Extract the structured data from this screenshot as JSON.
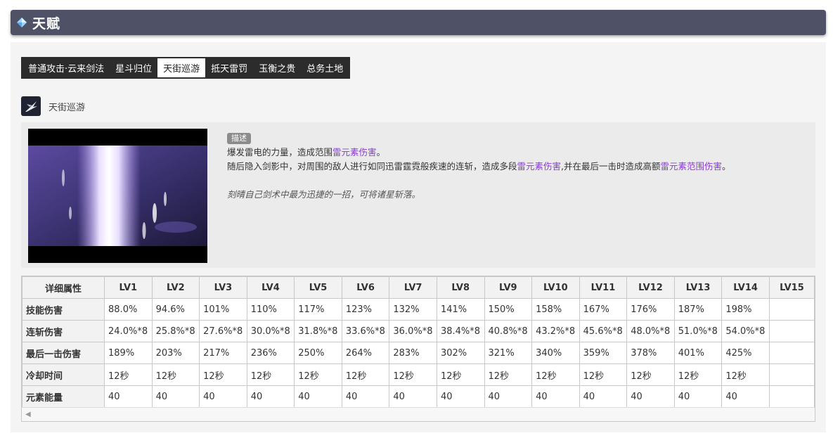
{
  "header": {
    "title": "天赋",
    "icon": "gem-icon",
    "bg_color": "#4f5266"
  },
  "tabs": [
    {
      "label": "普通攻击·云来剑法",
      "active": false
    },
    {
      "label": "星斗归位",
      "active": false
    },
    {
      "label": "天街巡游",
      "active": true
    },
    {
      "label": "抵天雷罚",
      "active": false
    },
    {
      "label": "玉衡之贵",
      "active": false
    },
    {
      "label": "总务土地",
      "active": false
    }
  ],
  "skill": {
    "name": "天街巡游",
    "icon": "skill-slash-icon",
    "desc_tag": "描述",
    "desc_line1_a": "爆发雷电的力量，造成范围",
    "desc_line1_hl": "雷元素伤害",
    "desc_line1_b": "。",
    "desc_line2_a": "随后隐入剑影中，对周围的敌人进行如同迅雷霆霓般疾速的连斩，造成多段",
    "desc_line2_hl1": "雷元素伤害",
    "desc_line2_b": ",并在最后一击时造成高额",
    "desc_line2_hl2": "雷元素范围伤害",
    "desc_line2_c": "。",
    "flavor": "刻晴自己剑术中最为迅捷的一招，可将诸星斩落。",
    "highlight_color": "#8a3bd6"
  },
  "table": {
    "corner": "详细属性",
    "levels": [
      "LV1",
      "LV2",
      "LV3",
      "LV4",
      "LV5",
      "LV6",
      "LV7",
      "LV8",
      "LV9",
      "LV10",
      "LV11",
      "LV12",
      "LV13",
      "LV14",
      "LV15"
    ],
    "rows": [
      {
        "label": "技能伤害",
        "values": [
          "88.0%",
          "94.6%",
          "101%",
          "110%",
          "117%",
          "123%",
          "132%",
          "141%",
          "150%",
          "158%",
          "167%",
          "176%",
          "187%",
          "198%",
          ""
        ]
      },
      {
        "label": "连斩伤害",
        "values": [
          "24.0%*8",
          "25.8%*8",
          "27.6%*8",
          "30.0%*8",
          "31.8%*8",
          "33.6%*8",
          "36.0%*8",
          "38.4%*8",
          "40.8%*8",
          "43.2%*8",
          "45.6%*8",
          "48.0%*8",
          "51.0%*8",
          "54.0%*8",
          ""
        ]
      },
      {
        "label": "最后一击伤害",
        "values": [
          "189%",
          "203%",
          "217%",
          "236%",
          "250%",
          "264%",
          "283%",
          "302%",
          "321%",
          "340%",
          "359%",
          "378%",
          "401%",
          "425%",
          ""
        ]
      },
      {
        "label": "冷却时间",
        "values": [
          "12秒",
          "12秒",
          "12秒",
          "12秒",
          "12秒",
          "12秒",
          "12秒",
          "12秒",
          "12秒",
          "12秒",
          "12秒",
          "12秒",
          "12秒",
          "12秒",
          ""
        ]
      },
      {
        "label": "元素能量",
        "values": [
          "40",
          "40",
          "40",
          "40",
          "40",
          "40",
          "40",
          "40",
          "40",
          "40",
          "40",
          "40",
          "40",
          "40",
          ""
        ]
      }
    ]
  }
}
